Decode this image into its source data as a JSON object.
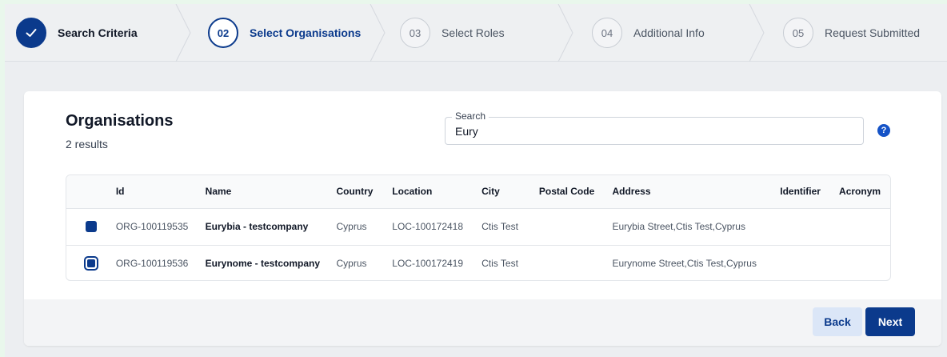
{
  "stepper": {
    "steps": [
      {
        "number": "",
        "label": "Search Criteria",
        "state": "done"
      },
      {
        "number": "02",
        "label": "Select Organisations",
        "state": "active"
      },
      {
        "number": "03",
        "label": "Select Roles",
        "state": "pending"
      },
      {
        "number": "04",
        "label": "Additional Info",
        "state": "pending"
      },
      {
        "number": "05",
        "label": "Request Submitted",
        "state": "pending"
      }
    ]
  },
  "organisations": {
    "title": "Organisations",
    "result_count": "2 results",
    "search": {
      "label": "Search",
      "value": "Eury"
    },
    "help_glyph": "?"
  },
  "table": {
    "columns": [
      "Id",
      "Name",
      "Country",
      "Location",
      "City",
      "Postal Code",
      "Address",
      "Identifier",
      "Acronym"
    ],
    "rows": [
      {
        "selected": true,
        "id": "ORG-100119535",
        "name": "Eurybia - testcompany",
        "country": "Cyprus",
        "location": "LOC-100172418",
        "city": "Ctis Test",
        "postal_code": "",
        "address": "Eurybia Street,Ctis Test,Cyprus",
        "identifier": "",
        "acronym": ""
      },
      {
        "selected": true,
        "id": "ORG-100119536",
        "name": "Eurynome - testcompany",
        "country": "Cyprus",
        "location": "LOC-100172419",
        "city": "Ctis Test",
        "postal_code": "",
        "address": "Eurynome Street,Ctis Test,Cyprus",
        "identifier": "",
        "acronym": ""
      }
    ]
  },
  "actions": {
    "back_label": "Back",
    "next_label": "Next"
  },
  "colors": {
    "primary": "#0b3a8c",
    "help": "#1553c7",
    "back_bg": "#dbe6f7"
  }
}
